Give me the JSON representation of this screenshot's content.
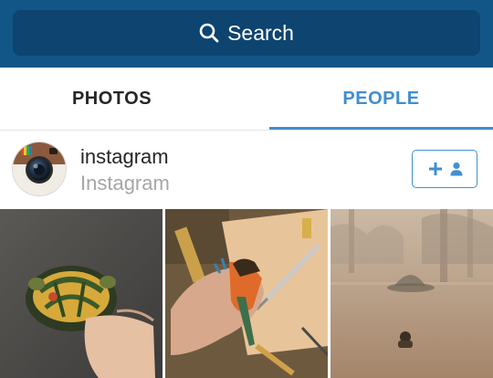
{
  "search": {
    "label": "Search"
  },
  "tabs": [
    {
      "label": "PHOTOS",
      "active": false
    },
    {
      "label": "PEOPLE",
      "active": true
    }
  ],
  "user": {
    "username": "instagram",
    "full_name": "Instagram"
  },
  "colors": {
    "header": "#125688",
    "search_field": "#0e4470",
    "accent": "#3f8fd2",
    "text_primary": "#262626",
    "text_secondary": "#a6a6a6"
  },
  "icons": [
    "search-icon",
    "instagram-logo",
    "follow-plus-icon",
    "person-icon"
  ],
  "photos": [
    {
      "subject": "turtle-held-in-hand"
    },
    {
      "subject": "paper-bird-craft-on-desk"
    },
    {
      "subject": "person-in-misty-lake"
    }
  ]
}
